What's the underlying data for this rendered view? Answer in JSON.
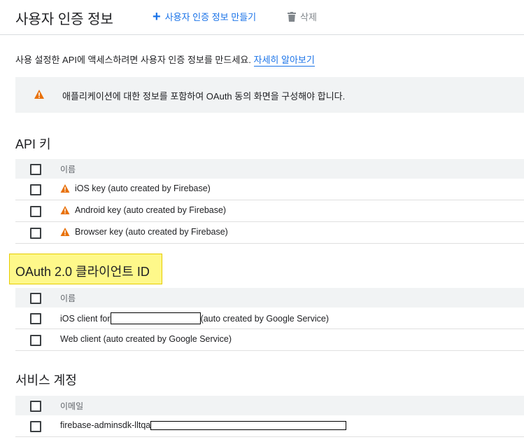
{
  "header": {
    "title": "사용자 인증 정보",
    "create_label": "사용자 인증 정보 만들기",
    "delete_label": "삭제"
  },
  "intro": {
    "text": "사용 설정한 API에 액세스하려면 사용자 인증 정보를 만드세요.",
    "link": "자세히 알아보기"
  },
  "warning_banner": {
    "text": "애플리케이션에 대한 정보를 포함하여 OAuth 동의 화면을 구성해야 합니다."
  },
  "api_keys": {
    "title": "API 키",
    "column_name": "이름",
    "rows": [
      {
        "name": "iOS key (auto created by Firebase)"
      },
      {
        "name": "Android key (auto created by Firebase)"
      },
      {
        "name": "Browser key (auto created by Firebase)"
      }
    ]
  },
  "oauth": {
    "title": "OAuth 2.0 클라이언트 ID",
    "column_name": "이름",
    "rows": [
      {
        "prefix": "iOS client for ",
        "suffix": "(auto created by Google Service)"
      },
      {
        "name": "Web client (auto created by Google Service)"
      }
    ]
  },
  "service_accounts": {
    "title": "서비스 계정",
    "column_email": "이메일",
    "rows": [
      {
        "prefix": "firebase-adminsdk-lltqa"
      }
    ]
  },
  "colors": {
    "accent": "#1a73e8",
    "warning": "#e8710a",
    "highlight": "#fef88a"
  },
  "icons": {
    "create": "plus-icon",
    "delete": "trash-icon",
    "warning": "warning-icon"
  }
}
